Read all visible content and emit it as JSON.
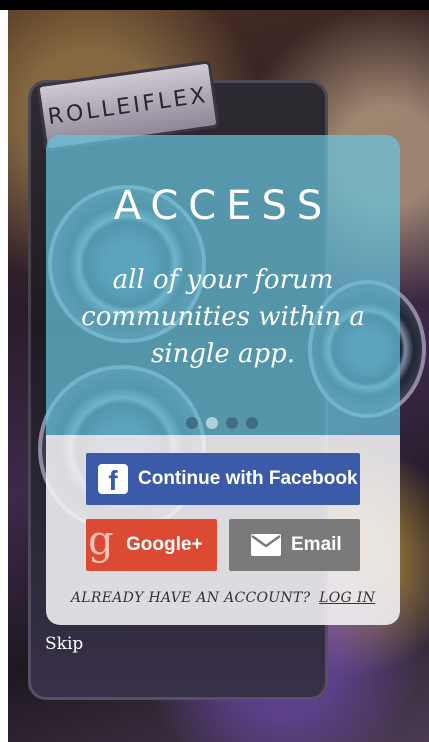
{
  "camera": {
    "brand_text": "ROLLEIFLEX"
  },
  "slide": {
    "title": "ACCESS",
    "tagline": "all of your forum communities within a single app.",
    "page_count": 4,
    "active_page": 2
  },
  "auth": {
    "facebook_label": "Continue with Facebook",
    "google_label": "Google+",
    "email_label": "Email",
    "have_account_text": "ALREADY HAVE AN ACCOUNT?",
    "login_label": "LOG IN"
  },
  "skip_label": "Skip",
  "colors": {
    "facebook": "#3b5aa7",
    "google": "#dc4a34",
    "email": "#7a7a7a",
    "overlay": "#69c3dc"
  },
  "icons": {
    "facebook": "facebook-f-icon",
    "google": "google-g-icon",
    "email": "envelope-icon"
  }
}
